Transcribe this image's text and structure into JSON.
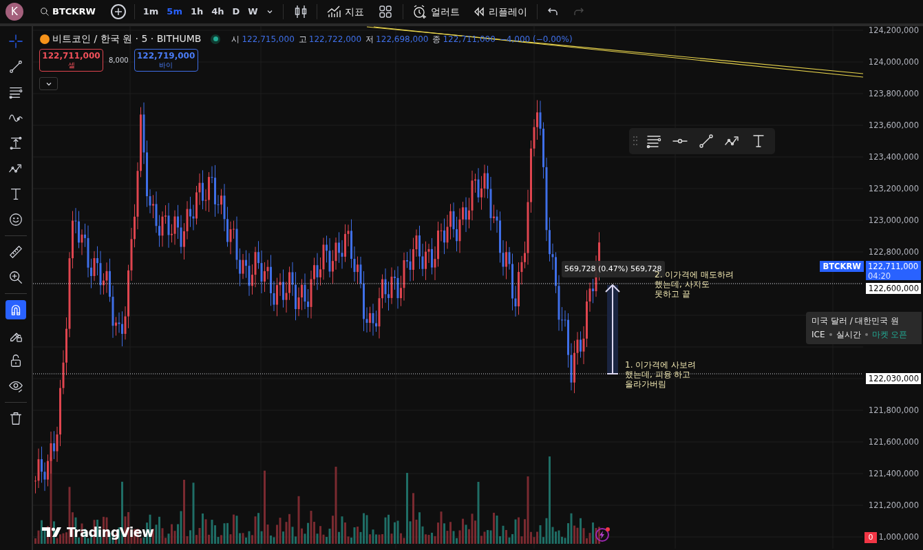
{
  "toolbar": {
    "avatar": "K",
    "symbol": "BTCKRW",
    "intervals": [
      {
        "label": "1m",
        "selected": false
      },
      {
        "label": "5m",
        "selected": true
      },
      {
        "label": "1h",
        "selected": false
      },
      {
        "label": "4h",
        "selected": false
      },
      {
        "label": "D",
        "selected": false
      },
      {
        "label": "W",
        "selected": false
      }
    ],
    "indicators": "지표",
    "alert": "얼러트",
    "replay": "리플레이"
  },
  "legend": {
    "title": "비트코인 / 한국 원 · 5 · BITHUMB",
    "ohlc": [
      {
        "label": "시",
        "value": "122,715,000"
      },
      {
        "label": "고",
        "value": "122,722,000"
      },
      {
        "label": "저",
        "value": "122,698,000"
      },
      {
        "label": "종",
        "value": "122,711,000"
      }
    ],
    "change": "−4,000 (−0.00%)"
  },
  "trade": {
    "sell_price": "122,711,000",
    "sell_label": "셀",
    "spread": "8,000",
    "buy_price": "122,719,000",
    "buy_label": "바이"
  },
  "tool_groups": [
    [
      {
        "kind": "crosshair",
        "selected": true
      },
      {
        "kind": "trendline",
        "selected": false
      },
      {
        "kind": "fib",
        "selected": false
      },
      {
        "kind": "brush",
        "selected": false
      },
      {
        "kind": "measure",
        "selected": false
      },
      {
        "kind": "pattern",
        "selected": false
      },
      {
        "kind": "text",
        "selected": false
      },
      {
        "kind": "emoji",
        "selected": false
      }
    ],
    [
      {
        "kind": "ruler",
        "selected": false
      },
      {
        "kind": "zoom",
        "selected": false
      }
    ],
    [
      {
        "kind": "magnet",
        "selected": false,
        "on": true
      },
      {
        "kind": "lock-drawing",
        "selected": false
      },
      {
        "kind": "lock",
        "selected": false
      },
      {
        "kind": "eye",
        "selected": false
      }
    ],
    [
      {
        "kind": "trash",
        "selected": false
      }
    ]
  ],
  "price_axis": {
    "labels": [
      "124,200,000",
      "124,000,000",
      "123,800,000",
      "123,600,000",
      "123,400,000",
      "123,200,000",
      "123,000,000",
      "122,800,000",
      "121,800,000",
      "121,600,000",
      "121,400,000",
      "121,200,000",
      "1,000,000"
    ],
    "last_price": {
      "symbol": "BTCKRW",
      "price": "122,711,000",
      "countdown": "04:20"
    },
    "line_labels": [
      "122,600,000",
      "122,030,000"
    ],
    "volume_badge": "0"
  },
  "measure_label": "569,728 (0.47%) 569,728",
  "notes": [
    "2. 이가격에 매도하려\n했는데, 사지도\n못하고 끝",
    "1. 이가격에 사보려\n했는데, 피융 하고\n올라가버림"
  ],
  "drawing_toolbar": [
    {
      "kind": "fib"
    },
    {
      "kind": "hline"
    },
    {
      "kind": "trendline"
    },
    {
      "kind": "pattern"
    },
    {
      "kind": "text"
    }
  ],
  "symbol_panel": {
    "title": "미국 달러 / 대한민국 원",
    "exchange": "ICE",
    "feed": "실시간",
    "status": "마켓 오픈"
  },
  "branding": "TradingView"
}
